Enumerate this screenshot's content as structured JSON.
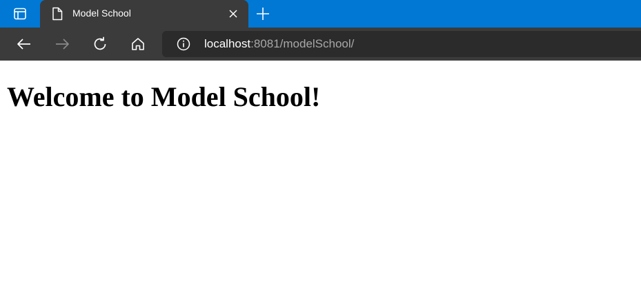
{
  "browser": {
    "tab": {
      "title": "Model School"
    },
    "address_bar": {
      "host": "localhost",
      "rest": ":8081/modelSchool/"
    },
    "icons": [
      "tab-actions-icon",
      "page-icon",
      "close-icon",
      "plus-icon",
      "back-arrow-icon",
      "forward-arrow-icon",
      "refresh-icon",
      "home-icon",
      "info-icon"
    ],
    "colors": {
      "tabbar": "#0078d4",
      "toolbar": "#3b3b3b",
      "address_bg": "#2b2b2b"
    }
  },
  "page": {
    "heading": "Welcome to Model School!"
  }
}
